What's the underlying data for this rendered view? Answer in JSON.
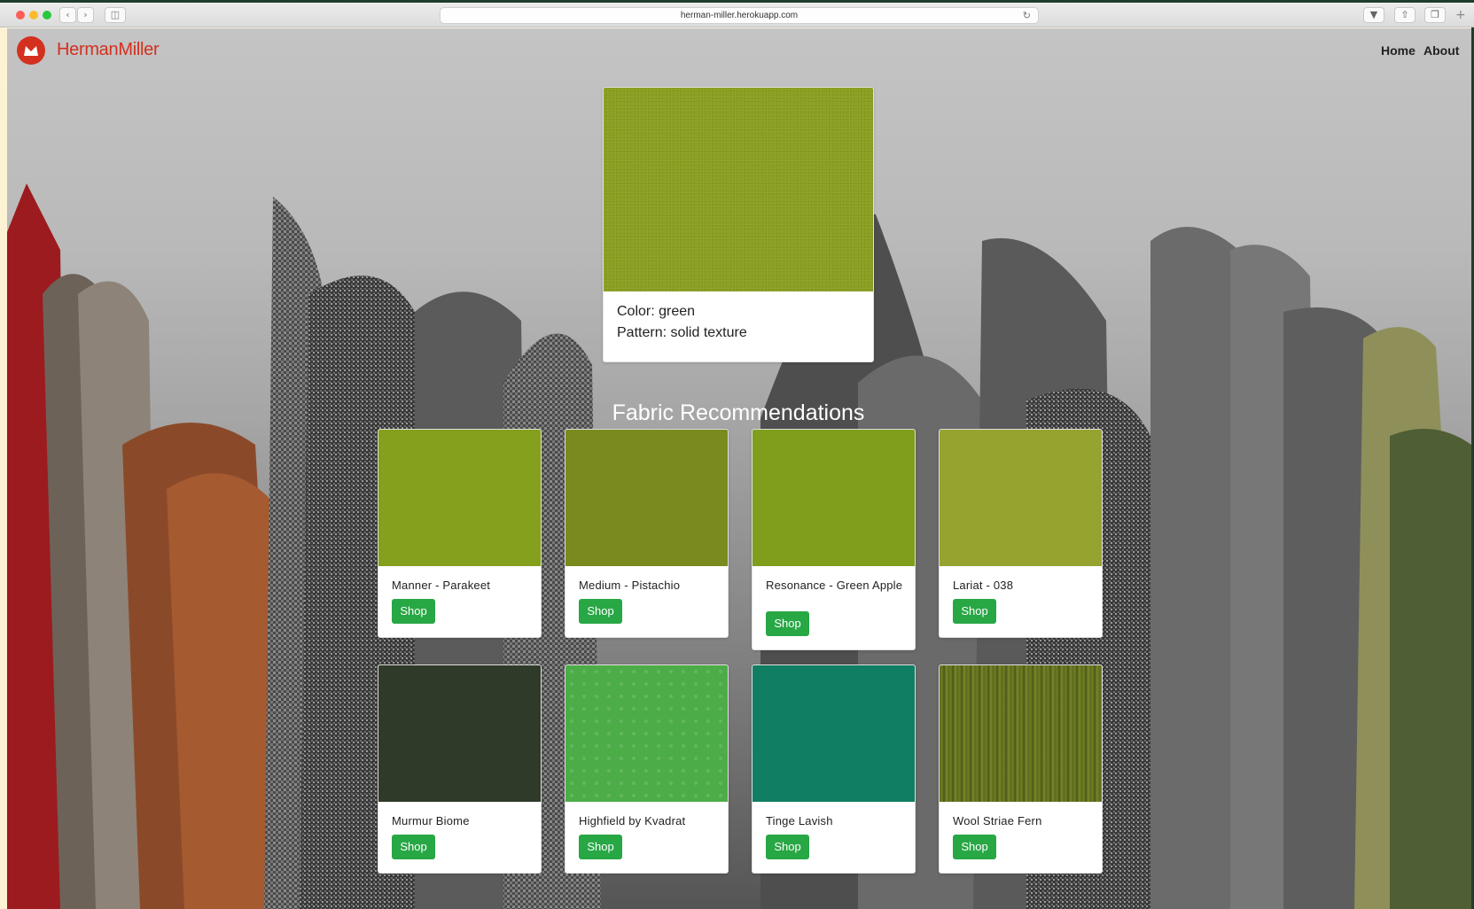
{
  "browser": {
    "url": "herman-miller.herokuapp.com",
    "icons": {
      "back": "chevron-left-icon",
      "forward": "chevron-right-icon",
      "sidebar": "sidebar-icon",
      "reload": "reload-icon",
      "download": "download-icon",
      "share": "share-icon",
      "tabs": "tabs-icon",
      "new_tab": "plus-icon"
    }
  },
  "navbar": {
    "brand": "HermanMiller",
    "brand_color": "#d4301f",
    "links": [
      "Home",
      "About"
    ]
  },
  "hero": {
    "swatch_color": "#8a9e1f",
    "color_line": "Color: green",
    "pattern_line": "Pattern: solid texture"
  },
  "recommendations": {
    "title": "Fabric Recommendations",
    "button_color": "#28a745",
    "items": [
      {
        "name": "Manner - Parakeet",
        "swatch": "#84a01c",
        "button": "Shop"
      },
      {
        "name": "Medium - Pistachio",
        "swatch": "#7a8a1e",
        "button": "Shop"
      },
      {
        "name": "Resonance - Green Apple",
        "swatch": "#7e9e1c",
        "button": "Shop"
      },
      {
        "name": "Lariat - 038",
        "swatch": "#96a32e",
        "button": "Shop"
      },
      {
        "name": "Murmur Biome",
        "swatch": "#2f3a29",
        "button": "Shop"
      },
      {
        "name": "Highfield by Kvadrat",
        "swatch": "#4cad48",
        "button": "Shop"
      },
      {
        "name": "Tinge Lavish",
        "swatch": "#107e62",
        "button": "Shop"
      },
      {
        "name": "Wool Striae Fern",
        "swatch": "#5b6a1e",
        "button": "Shop"
      }
    ]
  }
}
